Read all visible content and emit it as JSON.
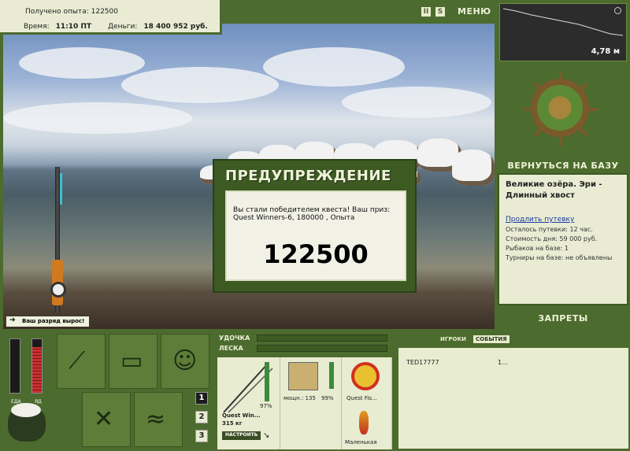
{
  "header": {
    "exp_label": "Получено опыта:",
    "exp_value": "122500",
    "time_label": "Время:",
    "time_value": "11:10 ПТ",
    "money_label": "Деньги:",
    "money_value": "18 400 952 руб.",
    "icons": [
      "pause-icon",
      "sound-icon"
    ],
    "pause_glyph": "II",
    "sound_glyph": "S",
    "menu_label": "МЕНЮ"
  },
  "depth_panel": {
    "value": "4,78 м"
  },
  "base": {
    "back_label": "ВЕРНУТЬСЯ НА БАЗУ",
    "location_title": "Великие озёра. Эри - Длинный хвост",
    "extend_link": "Продлить путевку",
    "remaining": "Осталось путевки: 12 час.",
    "cost": "Стоимость дня: 59 000 руб.",
    "anglers": "Рыбаков на базе: 1",
    "tournaments": "Турниры на базе: не объявлены",
    "bans_label": "ЗАПРЕТЫ"
  },
  "rank_message": "Ваш разряд вырос!",
  "meters": {
    "food_label": "ЕДА",
    "poison_label": "ЯД",
    "food_level": 0.0,
    "poison_level": 0.85,
    "colors": {
      "poison": "#c83030",
      "food": "#2c7a2c"
    }
  },
  "inventory_tiles": [
    "rods-icon",
    "tackle-box-icon",
    "angler-icon",
    "food-icon",
    "fish-icon"
  ],
  "slot_numbers": [
    "1",
    "2",
    "3"
  ],
  "tackle": {
    "rod_label": "УДОЧКА",
    "line_label": "ЛЕСКА",
    "rod_name": "Quest Win...",
    "rod_weight": "315 кг",
    "rod_percent": "97%",
    "reel_label": "мощн.: 135",
    "reel_percent": "99%",
    "line_name": "Quest Fis...",
    "lure_name": "Маленькая",
    "setup_button": "НАСТРОИТЬ"
  },
  "events": {
    "tabs": [
      "ИГРОКИ",
      "СОБЫТИЯ"
    ],
    "active_tab": "СОБЫТИЯ",
    "rows": [
      {
        "player": "TED17777",
        "value": "1..."
      }
    ]
  },
  "modal": {
    "title": "ПРЕДУПРЕЖДЕНИЕ",
    "message": "Вы стали победителем квеста! Ваш приз: Quest Winners-6, 180000 , Опыта",
    "big_number": "122500"
  }
}
